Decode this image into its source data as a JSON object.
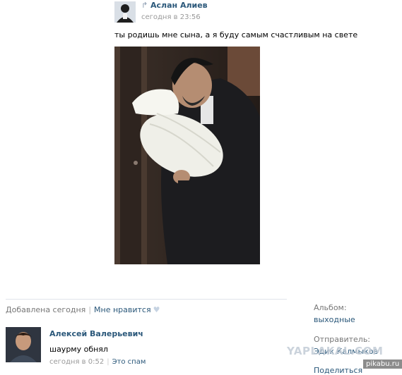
{
  "post": {
    "author": "Аслан Алиев",
    "time": "сегодня в 23:56",
    "text": "ты родишь мне сына, а я буду самым счастливым на свете"
  },
  "photo_footer": {
    "added": "Добавлена сегодня",
    "like_label": "Мне нравится"
  },
  "sidebar": {
    "album_label": "Альбом:",
    "album_value": "выходные",
    "sender_label": "Отправитель:",
    "sender_value": "Эдик Калмыков",
    "share_label": "Поделиться"
  },
  "comment": {
    "author": "Алексей Валерьевич",
    "text": "шаурму обнял",
    "time": "сегодня в 0:52",
    "spam_label": "Это спам"
  },
  "watermarks": {
    "yaplakal": "YAPLAKAL.COM",
    "pikabu": "pikabu.ru"
  },
  "colors": {
    "link": "#2b587a",
    "meta": "#999999"
  }
}
